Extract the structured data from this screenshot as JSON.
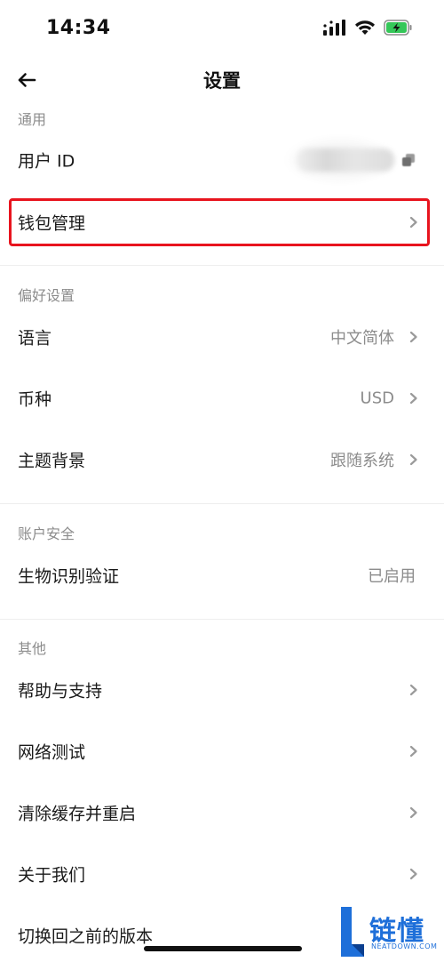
{
  "status_bar": {
    "time": "14:34"
  },
  "header": {
    "title": "设置"
  },
  "sections": {
    "general": {
      "title": "通用",
      "user_id_label": "用户 ID",
      "wallet_label": "钱包管理"
    },
    "preferences": {
      "title": "偏好设置",
      "language_label": "语言",
      "language_value": "中文简体",
      "currency_label": "币种",
      "currency_value": "USD",
      "theme_label": "主题背景",
      "theme_value": "跟随系统"
    },
    "security": {
      "title": "账户安全",
      "biometric_label": "生物识别验证",
      "biometric_value": "已启用"
    },
    "other": {
      "title": "其他",
      "help_label": "帮助与支持",
      "network_label": "网络测试",
      "clear_cache_label": "清除缓存并重启",
      "about_label": "关于我们",
      "switch_version_label": "切换回之前的版本"
    }
  },
  "watermark": {
    "text": "链懂",
    "sub": "NEATDOWN.COM"
  },
  "colors": {
    "highlight": "#e8141e",
    "muted_text": "#8c8c8c",
    "watermark": "#1e6fd9"
  },
  "icons": {
    "back": "arrow-left-icon",
    "chevron": "chevron-right-icon",
    "copy": "copy-icon",
    "signal": "signal-icon",
    "wifi": "wifi-icon",
    "battery": "battery-charging-icon"
  }
}
